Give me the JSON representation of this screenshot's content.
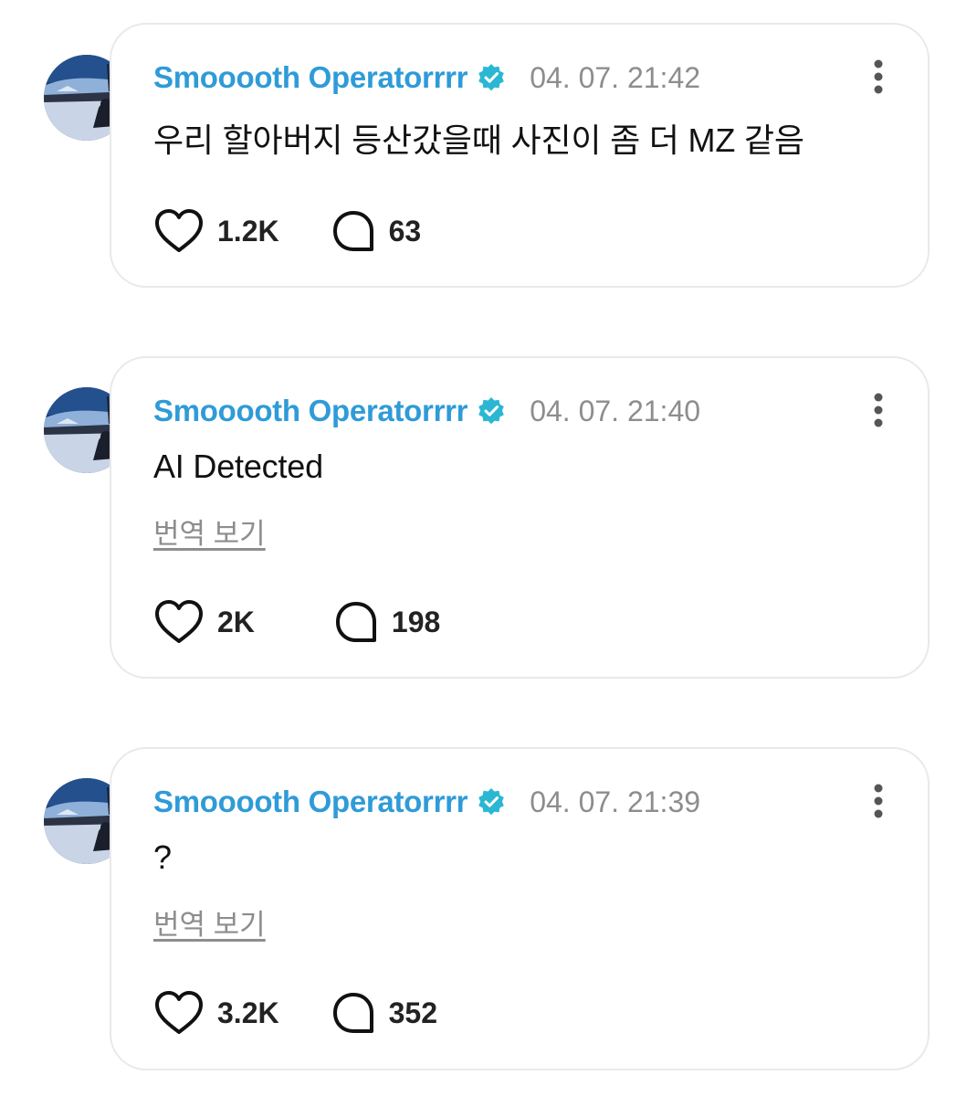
{
  "colors": {
    "username": "#2f9bd8",
    "verified": "#2bb7d4",
    "timestamp": "#8d8d8d",
    "card_border": "#e9e9e9"
  },
  "comments": [
    {
      "username": "Smooooth Operatorrrr",
      "verified_icon": "verified-badge-icon",
      "timestamp": "04. 07. 21:42",
      "text": "우리 할아버지 등산갔을때 사진이 좀 더 MZ 같음",
      "translate_link": "",
      "likes": "1.2K",
      "replies": "63"
    },
    {
      "username": "Smooooth Operatorrrr",
      "verified_icon": "verified-badge-icon",
      "timestamp": "04. 07. 21:40",
      "text": "AI Detected",
      "translate_link": "번역 보기",
      "likes": "2K",
      "replies": "198"
    },
    {
      "username": "Smooooth Operatorrrr",
      "verified_icon": "verified-badge-icon",
      "timestamp": "04. 07. 21:39",
      "text": "?",
      "translate_link": "번역 보기",
      "likes": "3.2K",
      "replies": "352"
    }
  ]
}
